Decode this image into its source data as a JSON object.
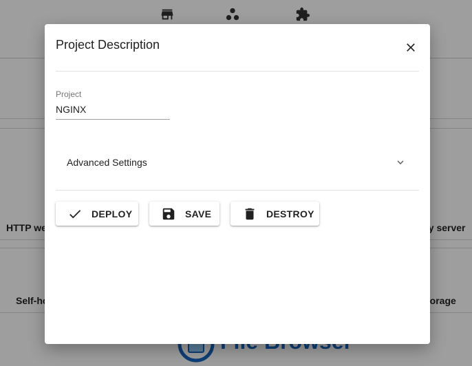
{
  "background": {
    "nav_icons": [
      "store-icon",
      "hub-icon",
      "extension-icon"
    ],
    "card_texts": [
      "HTTP we",
      "xy server",
      "Self-ho",
      "torage"
    ],
    "logo_text": "File Browser"
  },
  "dialog": {
    "title": "Project Description",
    "close_icon": "close-icon",
    "project_field": {
      "label": "Project",
      "value": "NGINX"
    },
    "advanced_settings": {
      "label": "Advanced Settings",
      "icon": "chevron-down-icon"
    },
    "actions": {
      "deploy": {
        "label": "DEPLOY",
        "icon": "check-icon"
      },
      "save": {
        "label": "SAVE",
        "icon": "save-icon"
      },
      "destroy": {
        "label": "DESTROY",
        "icon": "trash-icon"
      }
    }
  },
  "colors": {
    "accent": "#1565c0",
    "overlay": "rgba(0,0,0,0.38)"
  }
}
